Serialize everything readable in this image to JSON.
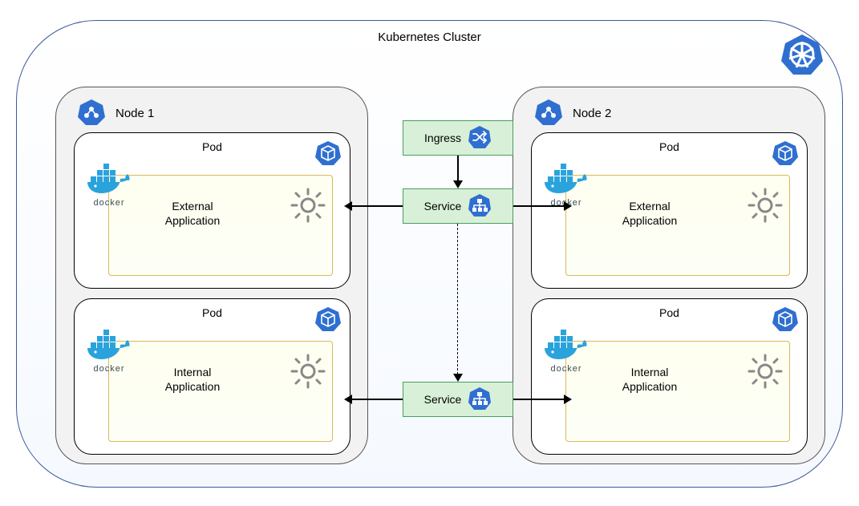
{
  "cluster": {
    "title": "Kubernetes Cluster"
  },
  "nodes": [
    {
      "label": "Node 1"
    },
    {
      "label": "Node 2"
    }
  ],
  "pod": {
    "title": "Pod"
  },
  "apps": {
    "external": "External\nApplication",
    "internal": "Internal\nApplication"
  },
  "docker": {
    "label": "docker"
  },
  "ingress": {
    "label": "Ingress"
  },
  "service": {
    "label": "Service"
  },
  "icons": {
    "k8s": "kubernetes-wheel-icon",
    "cube": "cube-icon",
    "gear": "gear-icon",
    "docker": "docker-whale-icon",
    "node": "node-hex-icon",
    "ingress": "ingress-shuffle-icon",
    "service": "service-tree-icon"
  }
}
